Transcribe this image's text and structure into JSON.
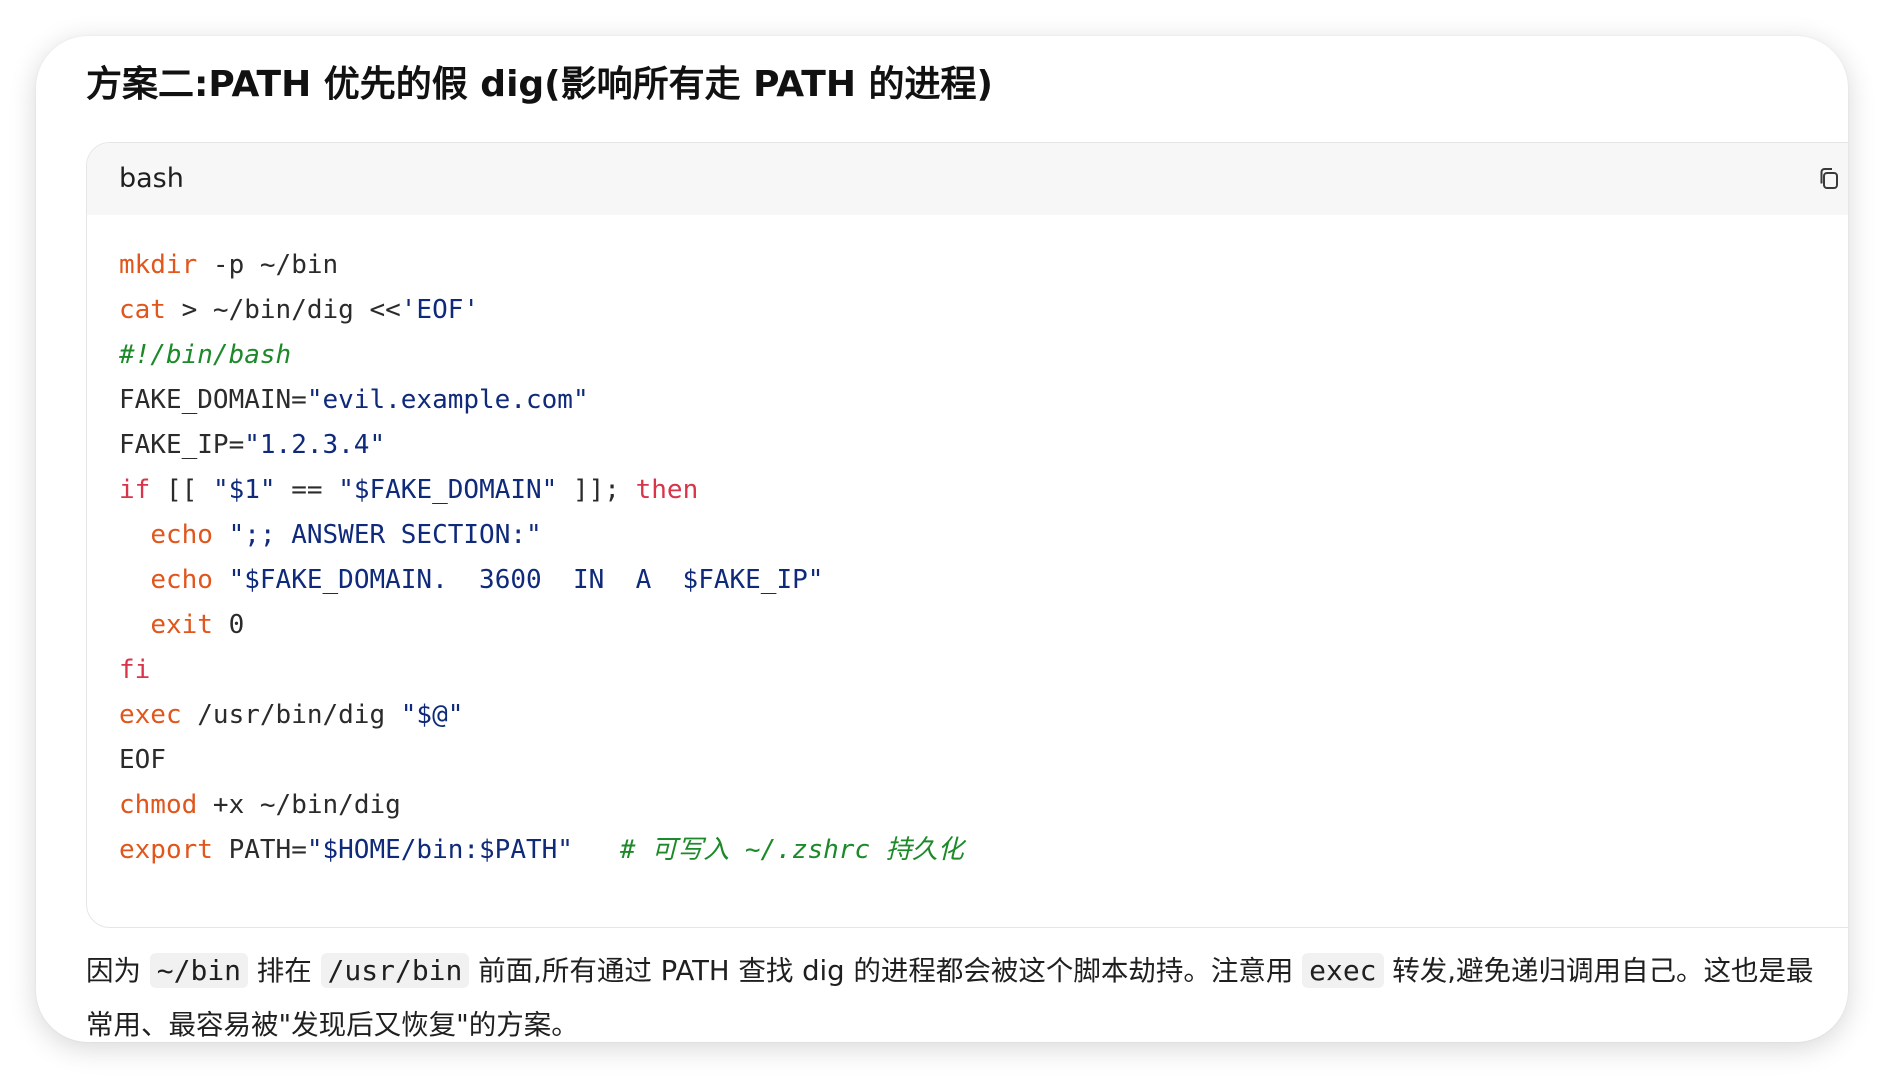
{
  "heading": "方案二:PATH 优先的假 dig(影响所有走 PATH 的进程)",
  "code_block": {
    "language": "bash",
    "copy_icon": "copy-icon",
    "lines": [
      [
        {
          "t": "mkdir",
          "c": "cmd"
        },
        {
          "t": " -p ~/bin",
          "c": "plain"
        }
      ],
      [
        {
          "t": "cat",
          "c": "cmd"
        },
        {
          "t": " > ~/bin/dig <<",
          "c": "plain"
        },
        {
          "t": "'EOF'",
          "c": "str"
        }
      ],
      [
        {
          "t": "#!/bin/bash",
          "c": "cmt"
        }
      ],
      [
        {
          "t": "FAKE_DOMAIN=",
          "c": "plain"
        },
        {
          "t": "\"evil.example.com\"",
          "c": "str"
        }
      ],
      [
        {
          "t": "FAKE_IP=",
          "c": "plain"
        },
        {
          "t": "\"1.2.3.4\"",
          "c": "str"
        }
      ],
      [
        {
          "t": "if",
          "c": "kw"
        },
        {
          "t": " [[ ",
          "c": "plain"
        },
        {
          "t": "\"$1\"",
          "c": "str"
        },
        {
          "t": " == ",
          "c": "plain"
        },
        {
          "t": "\"$FAKE_DOMAIN\"",
          "c": "str"
        },
        {
          "t": " ]]; ",
          "c": "plain"
        },
        {
          "t": "then",
          "c": "kw"
        }
      ],
      [
        {
          "t": "  ",
          "c": "plain"
        },
        {
          "t": "echo",
          "c": "cmd"
        },
        {
          "t": " ",
          "c": "plain"
        },
        {
          "t": "\";; ANSWER SECTION:\"",
          "c": "str"
        }
      ],
      [
        {
          "t": "  ",
          "c": "plain"
        },
        {
          "t": "echo",
          "c": "cmd"
        },
        {
          "t": " ",
          "c": "plain"
        },
        {
          "t": "\"$FAKE_DOMAIN.  3600  IN  A  $FAKE_IP\"",
          "c": "str"
        }
      ],
      [
        {
          "t": "  ",
          "c": "plain"
        },
        {
          "t": "exit",
          "c": "cmd"
        },
        {
          "t": " 0",
          "c": "plain"
        }
      ],
      [
        {
          "t": "fi",
          "c": "kw"
        }
      ],
      [
        {
          "t": "exec",
          "c": "cmd"
        },
        {
          "t": " /usr/bin/dig ",
          "c": "plain"
        },
        {
          "t": "\"$@\"",
          "c": "str"
        }
      ],
      [
        {
          "t": "EOF",
          "c": "plain"
        }
      ],
      [
        {
          "t": "chmod",
          "c": "cmd"
        },
        {
          "t": " +x ~/bin/dig",
          "c": "plain"
        }
      ],
      [
        {
          "t": "export",
          "c": "cmd"
        },
        {
          "t": " PATH=",
          "c": "plain"
        },
        {
          "t": "\"$HOME/bin:$PATH\"",
          "c": "str"
        },
        {
          "t": "   ",
          "c": "plain"
        },
        {
          "t": "# 可写入 ~/.zshrc 持久化",
          "c": "cmt"
        }
      ]
    ]
  },
  "paragraph": {
    "segments": [
      {
        "t": "因为 ",
        "code": false
      },
      {
        "t": "~/bin",
        "code": true
      },
      {
        "t": " 排在 ",
        "code": false
      },
      {
        "t": "/usr/bin",
        "code": true
      },
      {
        "t": " 前面,所有通过 PATH 查找 dig 的进程都会被这个脚本劫持。注意用 ",
        "code": false
      },
      {
        "t": "exec",
        "code": true
      },
      {
        "t": " 转发,避免递归调用自己。这也是最常用、最容易被\"发现后又恢复\"的方案。",
        "code": false
      }
    ]
  }
}
